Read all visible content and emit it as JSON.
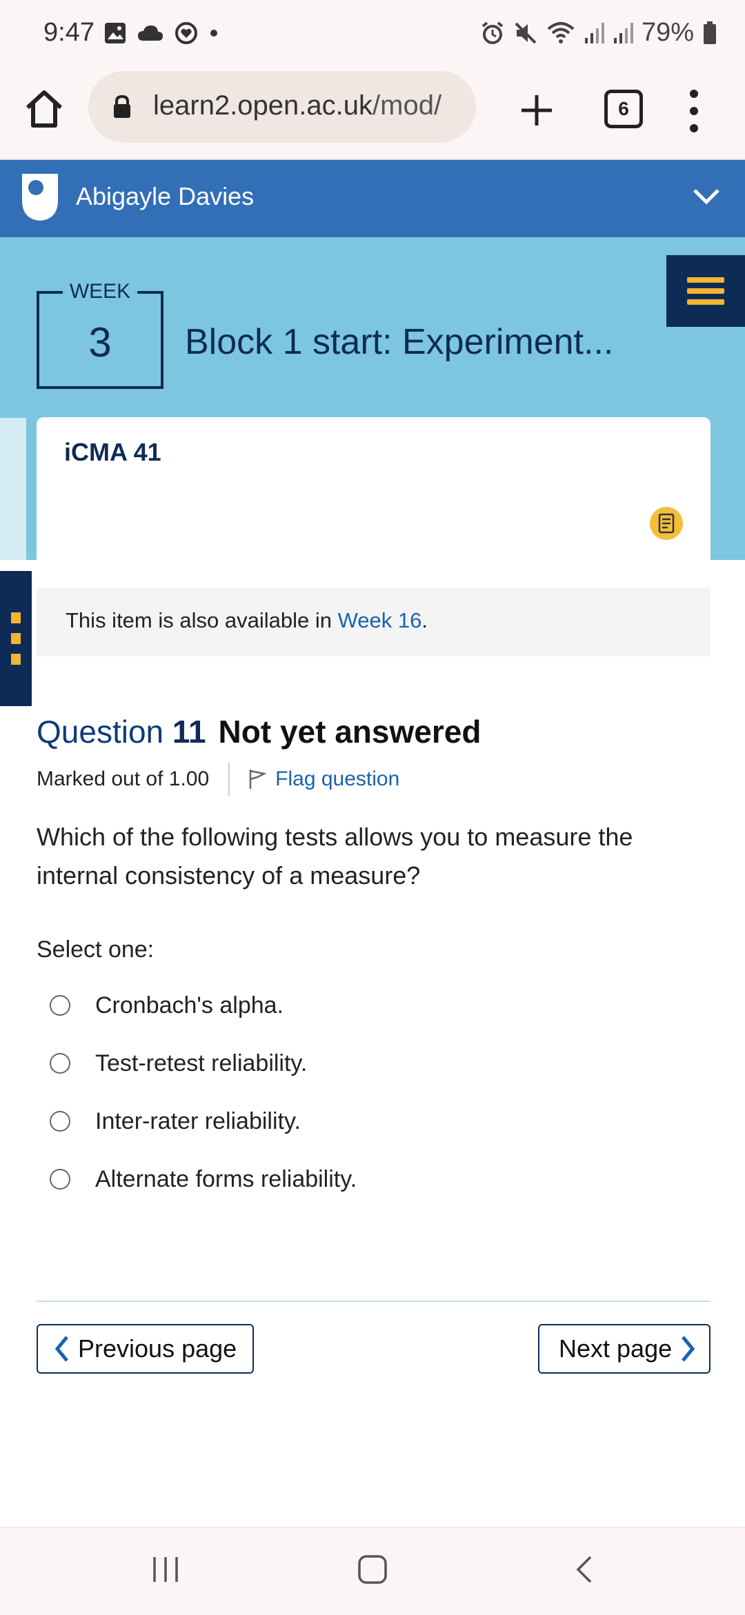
{
  "status_bar": {
    "time": "9:47",
    "battery": "79%"
  },
  "browser": {
    "url_host": "learn2.open.ac.uk",
    "url_path": "/mod/",
    "tab_count": "6"
  },
  "header": {
    "user_name": "Abigayle Davies"
  },
  "week": {
    "label": "WEEK",
    "number": "3",
    "title": "Block 1 start: Experiment..."
  },
  "card": {
    "title": "iCMA 41"
  },
  "notice": {
    "text_before": "This item is also available in ",
    "link": "Week 16",
    "text_after": "."
  },
  "question": {
    "label": "Question",
    "number": "11",
    "state": "Not yet answered",
    "marked": "Marked out of 1.00",
    "flag": "Flag question",
    "text": "Which of the following tests allows you to measure the internal consistency of a measure?",
    "select_label": "Select one:",
    "options": [
      "Cronbach's alpha.",
      "Test-retest reliability.",
      "Inter-rater reliability.",
      "Alternate forms reliability."
    ]
  },
  "navigation": {
    "previous": "Previous page",
    "next": "Next page"
  },
  "colors": {
    "header_blue": "#326fb6",
    "banner_blue": "#7cc6e0",
    "navy": "#0e2b55",
    "accent_yellow": "#f2b431",
    "link_blue": "#1a62ae"
  }
}
